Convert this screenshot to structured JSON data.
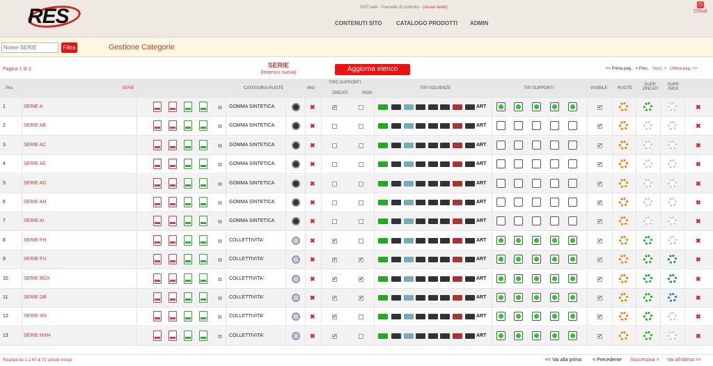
{
  "header": {
    "logo": "RES",
    "top_line": "DOT-web - Pannello di controllo - ",
    "top_user": "(Anuar Arebi)",
    "nav": [
      "CONTENUTI SITO",
      "CATALOGO PRODOTTI",
      "ADMIN"
    ],
    "close_label": "Chiudi"
  },
  "filter": {
    "placeholder": "Nome SERIE",
    "button": "Filtra",
    "title": "Gestione Categorie"
  },
  "list": {
    "pagina": "Pagina 1 di 2",
    "title": "SERIE",
    "subtitle": "(Inserisci nuova)",
    "update_button": "Aggiorna elenco",
    "pager_top": {
      "first": "<< Prima pag.",
      "prev": "< Prec.",
      "next": "Succ. >",
      "last": "Ultima pag. >>"
    }
  },
  "columns": {
    "pos": "Pos.",
    "serie": "SERIE",
    "categoria": "CATEGORIA RUOTE",
    "img": "IMG",
    "tipo_supporti": "TIPO SUPPORTI",
    "zincati": "ZINCATI",
    "inox": "INOX",
    "tipi_volvenze": "TIPI VOLVENZE",
    "tipi_supporti": "TIPI SUPPORTI",
    "visibile": "VISIBILE",
    "ruote": "RUOTE",
    "supp_zincati": "SUPP. ZINCATI",
    "supp_inox": "SUPP. INOX"
  },
  "rows": [
    {
      "pos": "1",
      "name": "SERIE A",
      "cat": "GOMMA SINTETICA",
      "zinc": true,
      "inox": false,
      "vis": true,
      "sz": "green",
      "si": "gray"
    },
    {
      "pos": "2",
      "name": "SERIE AB",
      "cat": "GOMMA SINTETICA",
      "zinc": false,
      "inox": false,
      "vis": true,
      "sz": "gray",
      "si": "gray"
    },
    {
      "pos": "3",
      "name": "SERIE AC",
      "cat": "GOMMA SINTETICA",
      "zinc": false,
      "inox": false,
      "vis": true,
      "sz": "gray",
      "si": "gray"
    },
    {
      "pos": "4",
      "name": "SERIE AE",
      "cat": "GOMMA SINTETICA",
      "zinc": false,
      "inox": false,
      "vis": true,
      "sz": "gray",
      "si": "gray"
    },
    {
      "pos": "5",
      "name": "SERIE AG",
      "cat": "GOMMA SINTETICA",
      "zinc": false,
      "inox": false,
      "vis": true,
      "sz": "gray",
      "si": "gray"
    },
    {
      "pos": "6",
      "name": "SERIE AH",
      "cat": "GOMMA SINTETICA",
      "zinc": false,
      "inox": false,
      "vis": true,
      "sz": "gray",
      "si": "gray"
    },
    {
      "pos": "7",
      "name": "SERIE AI",
      "cat": "GOMMA SINTETICA",
      "zinc": false,
      "inox": false,
      "vis": true,
      "sz": "gray",
      "si": "gray"
    },
    {
      "pos": "8",
      "name": "SERIE FH",
      "cat": "COLLETTIVITA'",
      "zinc": true,
      "inox": false,
      "vis": true,
      "sz": "green",
      "si": "gray"
    },
    {
      "pos": "9",
      "name": "SERIE FU",
      "cat": "COLLETTIVITA'",
      "zinc": true,
      "inox": true,
      "vis": true,
      "sz": "green",
      "si": "blue"
    },
    {
      "pos": "10",
      "name": "SERIE BOX",
      "cat": "COLLETTIVITA'",
      "zinc": true,
      "inox": true,
      "vis": true,
      "sz": "green",
      "si": "blue"
    },
    {
      "pos": "11",
      "name": "SERIE DB",
      "cat": "COLLETTIVITA'",
      "zinc": true,
      "inox": true,
      "vis": true,
      "sz": "green",
      "si": "blue"
    },
    {
      "pos": "12",
      "name": "SERIE MX",
      "cat": "COLLETTIVITA'",
      "zinc": true,
      "inox": false,
      "vis": true,
      "sz": "green",
      "si": "gray"
    },
    {
      "pos": "13",
      "name": "SERIE MXH",
      "cat": "COLLETTIVITA'",
      "zinc": true,
      "inox": false,
      "vis": true,
      "sz": "green",
      "si": "gray"
    }
  ],
  "art_label": "ART",
  "check_mark": "✔",
  "delete_mark": "✖",
  "icons": {
    "pdf": "pdf-icon",
    "wheel": "wheel-image-icon",
    "gear": "gear-icon",
    "support": "caster-support-icon"
  },
  "footer": {
    "results": "Risultati da 1 a 40 di 72 articoli trovati",
    "first": "<< Vai alla prima",
    "prev": "< Precedente",
    "next": "Successiva >",
    "last": "Vai all'ultima >>"
  },
  "colors": {
    "accent": "#dd2222",
    "header_bg": "#eeeae3",
    "filter_bg": "#fdf6e0"
  }
}
